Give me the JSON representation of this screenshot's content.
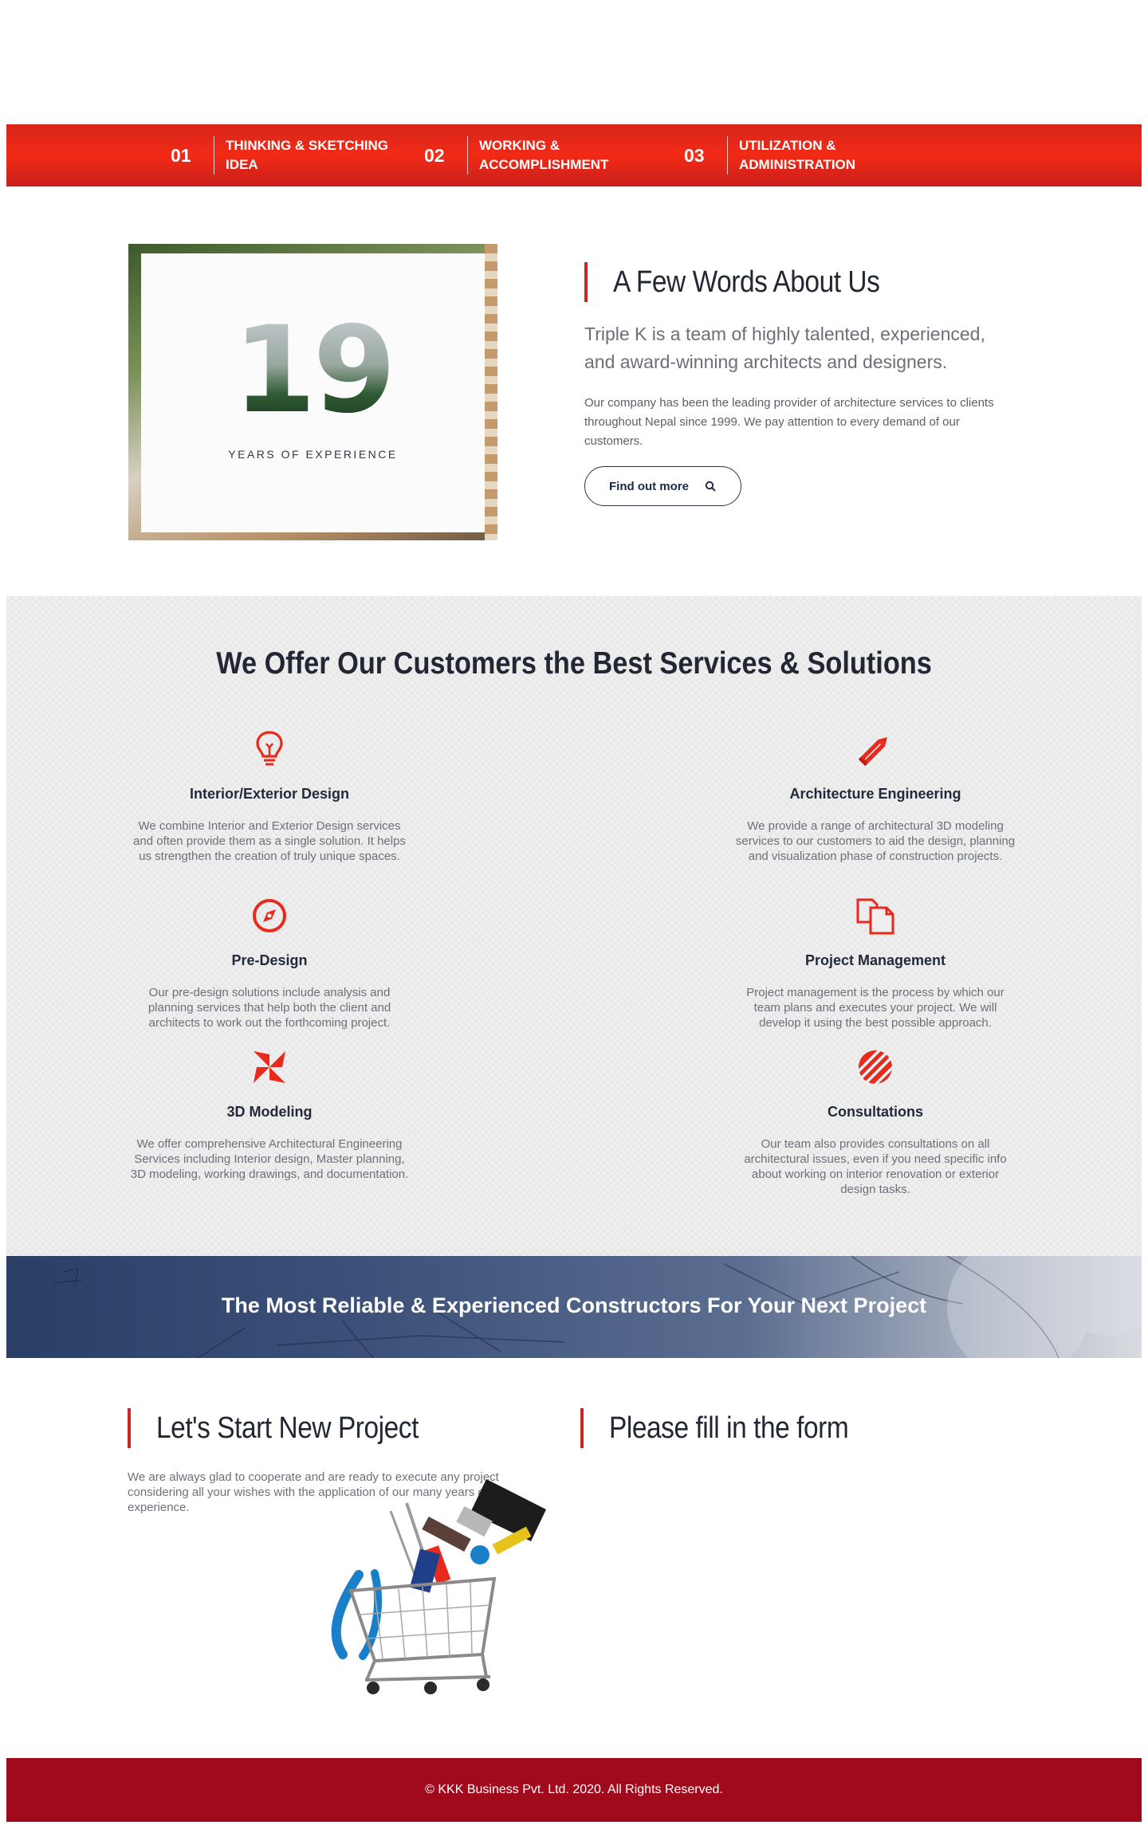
{
  "steps": [
    {
      "number": "01",
      "label": "THINKING & SKETCHING IDEA"
    },
    {
      "number": "02",
      "label": "WORKING & ACCOMPLISHMENT"
    },
    {
      "number": "03",
      "label": "UTILIZATION & ADMINISTRATION"
    }
  ],
  "experience": {
    "number": "19",
    "caption": "YEARS OF EXPERIENCE"
  },
  "about": {
    "title": "A Few Words About Us",
    "lead": "Triple K is a team of highly talented, experienced, and award-winning architects and designers.",
    "body": "Our company has been the leading provider of architecture services to clients throughout Nepal since 1999. We pay attention to every demand of our customers.",
    "button_label": "Find out more"
  },
  "services": {
    "title": "We Offer Our Customers the Best Services & Solutions",
    "items": [
      {
        "name": "Interior/Exterior Design",
        "icon": "lightbulb-icon",
        "desc": "We combine Interior and Exterior Design services and often provide them as a single solution. It helps us strengthen the creation of truly unique spaces."
      },
      {
        "name": "Architecture Engineering",
        "icon": "pencil-icon",
        "desc": "We provide a range of architectural 3D modeling services to our customers to aid the design, planning and visualization phase of construction projects."
      },
      {
        "name": "Pre-Design",
        "icon": "compass-icon",
        "desc": "Our pre-design solutions include analysis and planning services that help both the client and architects to work out the forthcoming project."
      },
      {
        "name": "Project Management",
        "icon": "documents-icon",
        "desc": "Project management is the process by which our team plans and executes your project. We will develop it using the best possible approach."
      },
      {
        "name": "3D Modeling",
        "icon": "pinwheel-icon",
        "desc": "We offer comprehensive Architectural Engineering Services including Interior design, Master planning, 3D modeling, working drawings, and documentation."
      },
      {
        "name": "Consultations",
        "icon": "signal-icon",
        "desc": "Our team also provides consultations on all architectural issues, even if you need specific info about working on interior renovation or exterior design tasks."
      }
    ]
  },
  "banner": {
    "text": "The Most Reliable & Experienced Constructors For Your Next Project"
  },
  "project": {
    "title": "Let's Start New Project",
    "body": "We are always glad to cooperate and are ready to execute any project considering all your wishes with the application of our many years of experience."
  },
  "form": {
    "title": "Please fill in the form"
  },
  "footer": {
    "text": "© KKK Business Pvt. Ltd. 2020. All Rights Reserved."
  },
  "colors": {
    "accent": "#c62828",
    "icon": "#e8291c",
    "footer": "#a10a1c"
  }
}
